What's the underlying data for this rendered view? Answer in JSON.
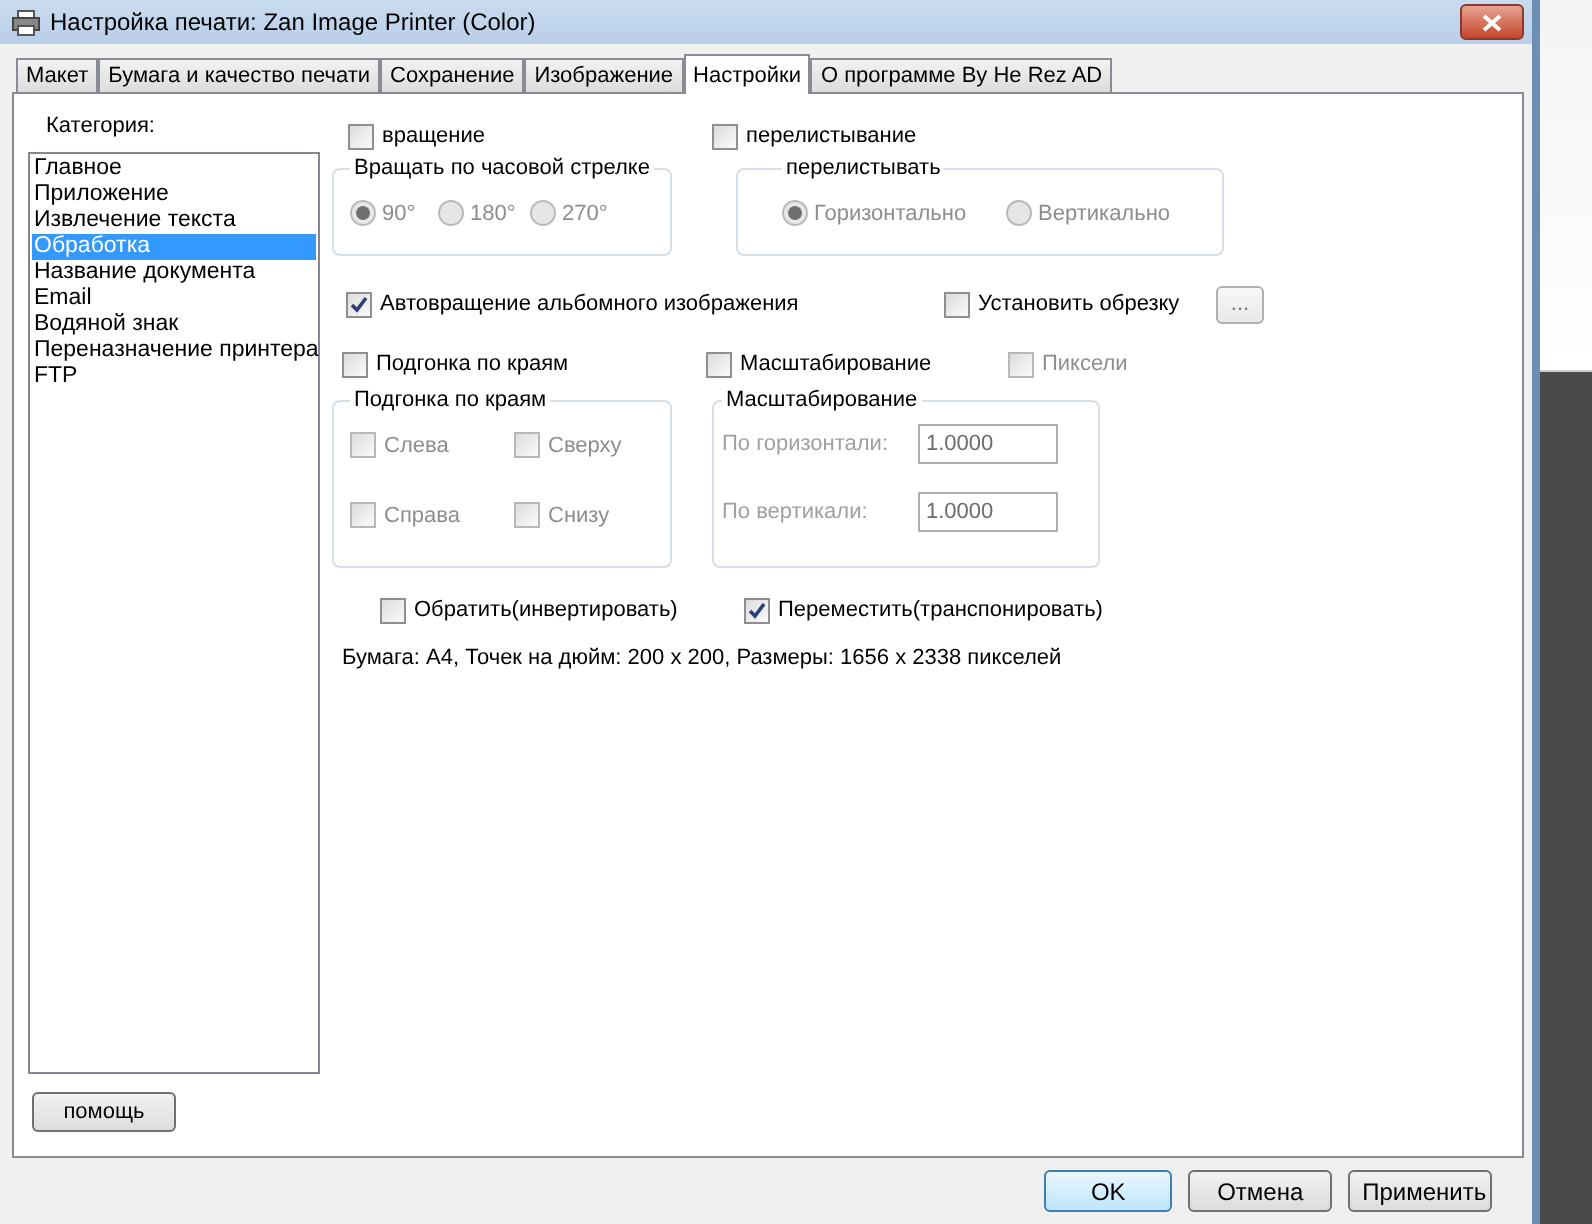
{
  "window": {
    "title": "Настройка печати: Zan Image Printer (Color)"
  },
  "tabs": [
    {
      "label": "Макет",
      "selected": false
    },
    {
      "label": "Бумага и качество печати",
      "selected": false
    },
    {
      "label": "Сохранение",
      "selected": false
    },
    {
      "label": "Изображение",
      "selected": false
    },
    {
      "label": "Настройки",
      "selected": true
    },
    {
      "label": "О программе By He Rez AD",
      "selected": false
    }
  ],
  "category": {
    "label": "Категория:",
    "items": [
      {
        "label": "Главное",
        "selected": false
      },
      {
        "label": "Приложение",
        "selected": false
      },
      {
        "label": "Извлечение текста",
        "selected": false
      },
      {
        "label": "Обработка",
        "selected": true
      },
      {
        "label": "Название документа",
        "selected": false
      },
      {
        "label": "Email",
        "selected": false
      },
      {
        "label": "Водяной знак",
        "selected": false
      },
      {
        "label": "Переназначение принтера",
        "selected": false
      },
      {
        "label": "FTP",
        "selected": false
      }
    ]
  },
  "help_button": "помощь",
  "rotation": {
    "label": "вращение",
    "checked": false,
    "group_title": "Вращать по часовой стрелке",
    "options": [
      {
        "label": "90°",
        "selected": true,
        "disabled": true
      },
      {
        "label": "180°",
        "selected": false,
        "disabled": true
      },
      {
        "label": "270°",
        "selected": false,
        "disabled": true
      }
    ]
  },
  "flip": {
    "label": "перелистывание",
    "checked": false,
    "group_title": "перелистывать",
    "options": [
      {
        "label": "Горизонтально",
        "selected": true,
        "disabled": true
      },
      {
        "label": "Вертикально",
        "selected": false,
        "disabled": true
      }
    ]
  },
  "autorotate": {
    "label": "Автовращение альбомного изображения",
    "checked": true
  },
  "crop": {
    "label": "Установить обрезку",
    "checked": false,
    "button_label": "..."
  },
  "fit": {
    "label": "Подгонка по краям",
    "checked": false,
    "group_title": "Подгонка по краям",
    "options": [
      {
        "label": "Слева",
        "checked": false,
        "disabled": true
      },
      {
        "label": "Сверху",
        "checked": false,
        "disabled": true
      },
      {
        "label": "Справа",
        "checked": false,
        "disabled": true
      },
      {
        "label": "Снизу",
        "checked": false,
        "disabled": true
      }
    ]
  },
  "scaling": {
    "label": "Масштабирование",
    "checked": false,
    "group_title": "Масштабирование",
    "fields": [
      {
        "label": "По горизонтали:",
        "value": "1.0000",
        "disabled": true
      },
      {
        "label": "По вертикали:",
        "value": "1.0000",
        "disabled": true
      }
    ]
  },
  "pixels": {
    "label": "Пиксели",
    "checked": false,
    "disabled": true
  },
  "invert": {
    "label": "Обратить(инвертировать)",
    "checked": false
  },
  "transpose": {
    "label": "Переместить(транспонировать)",
    "checked": true
  },
  "info": "Бумага: A4, Точек на дюйм: 200 x 200, Размеры: 1656 x 2338 пикселей",
  "buttons": [
    {
      "label": "OK",
      "default": true
    },
    {
      "label": "Отмена",
      "default": false
    },
    {
      "label": "Применить",
      "default": false
    }
  ]
}
